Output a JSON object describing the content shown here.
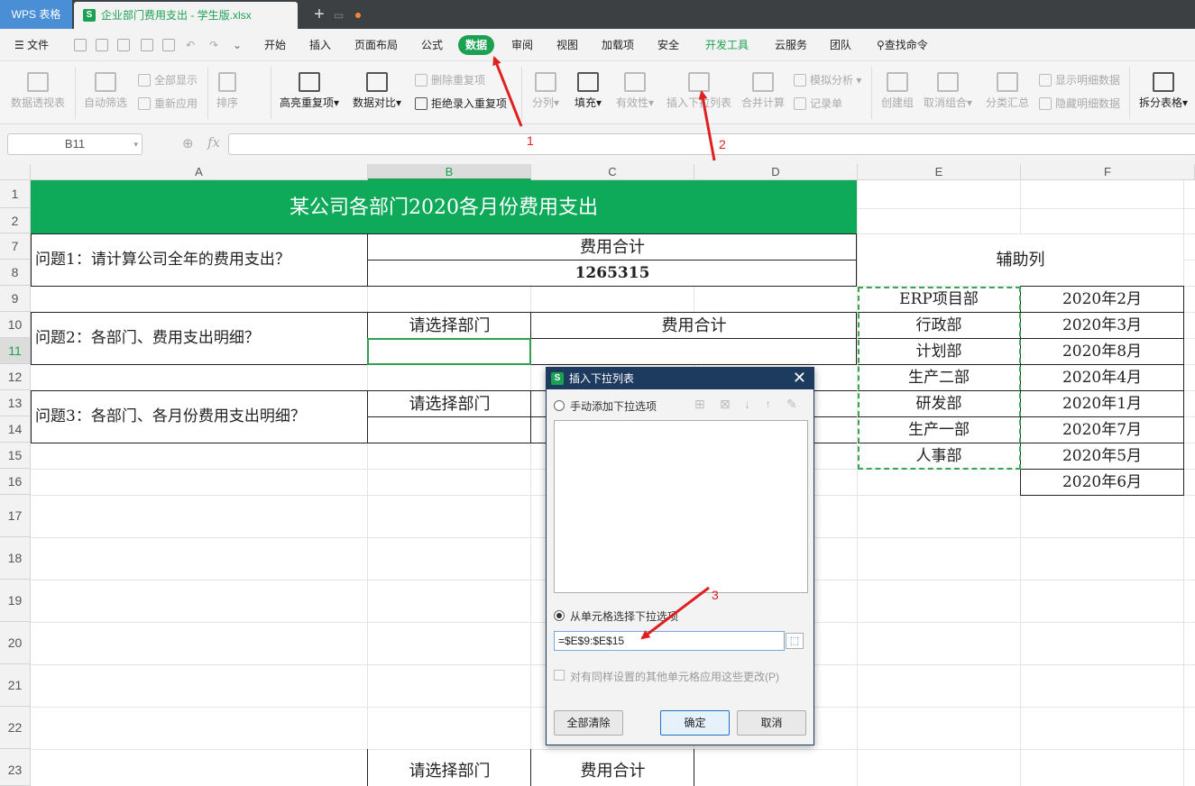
{
  "titlebar": {
    "app": "WPS 表格",
    "doc": "企业部门费用支出 - 学生版.xlsx",
    "new_tab": "+"
  },
  "menu": {
    "file": "文件",
    "tabs": [
      "开始",
      "插入",
      "页面布局",
      "公式",
      "数据",
      "审阅",
      "视图",
      "加载项",
      "安全",
      "开发工具",
      "云服务",
      "团队"
    ],
    "active": "数据",
    "search": "查找命令"
  },
  "ribbon": {
    "pivot": "数据透视表",
    "autofilter": "自动筛选",
    "showall": "全部显示",
    "reapply": "重新应用",
    "sort": "排序",
    "highlight_dup": "高亮重复项",
    "compare": "数据对比",
    "remove_dup": "删除重复项",
    "reject_dup": "拒绝录入重复项",
    "split": "分列",
    "fill": "填充",
    "validity": "有效性",
    "insert_dropdown": "插入下拉列表",
    "consolidate": "合并计算",
    "simulate": "模拟分析",
    "record": "记录单",
    "group": "创建组",
    "ungroup": "取消组合",
    "subtotal": "分类汇总",
    "show_detail": "显示明细数据",
    "hide_detail": "隐藏明细数据",
    "split_table": "拆分表格"
  },
  "formula_bar": {
    "cell_ref": "B11",
    "fx": "fx",
    "formula": ""
  },
  "columns": [
    "A",
    "B",
    "C",
    "D",
    "E",
    "F"
  ],
  "rows": [
    "1",
    "2",
    "7",
    "8",
    "9",
    "10",
    "11",
    "12",
    "13",
    "14",
    "15",
    "16",
    "17",
    "18",
    "19",
    "20",
    "21",
    "22",
    "23"
  ],
  "sheet": {
    "title": "某公司各部门2020各月份费用支出",
    "q1": "问题1：请计算公司全年的费用支出？",
    "expense_total_label": "费用合计",
    "expense_total_value": "1265315",
    "helper_col": "辅助列",
    "q2": "问题2：各部门、费用支出明细？",
    "select_dept": "请选择部门",
    "q3": "问题3：各部门、各月份费用支出明细？",
    "departments": [
      "ERP项目部",
      "行政部",
      "计划部",
      "生产二部",
      "研发部",
      "生产一部",
      "人事部"
    ],
    "months": [
      "2020年2月",
      "2020年3月",
      "2020年8月",
      "2020年4月",
      "2020年1月",
      "2020年7月",
      "2020年5月",
      "2020年6月"
    ],
    "row23_select": "请选择部门",
    "row23_total": "费用合计"
  },
  "dialog": {
    "title": "插入下拉列表",
    "close": "✕",
    "opt_manual": "手动添加下拉选项",
    "opt_from_cells": "从单元格选择下拉选项",
    "range": "=$E$9:$E$15",
    "apply_same": "对有同样设置的其他单元格应用这些更改(P)",
    "clear_all": "全部清除",
    "ok": "确定",
    "cancel": "取消"
  },
  "annotations": [
    "1",
    "2",
    "3"
  ],
  "colors": {
    "accent": "#1ca153",
    "dialog_header": "#1d3a5f",
    "annotation": "#e02020",
    "wps_blue": "#4a8fd6"
  }
}
